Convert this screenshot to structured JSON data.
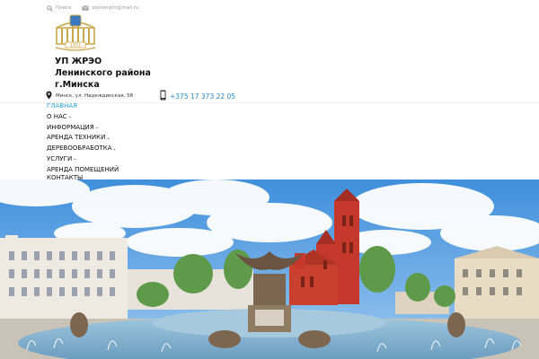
{
  "topbar": {
    "search_label": "Поиск",
    "email": "zooleniprr@mail.ru"
  },
  "logo": {
    "year": "1951"
  },
  "org": {
    "title_line1": "УП ЖРЭО",
    "title_line2": "Ленинского района",
    "title_line3": "г.Минска"
  },
  "contacts": {
    "address": "Минск, ул. Надеждинская, 58",
    "phone": "+375 17 373 22 05"
  },
  "nav": {
    "items": [
      {
        "label": "ГЛАВНАЯ"
      },
      {
        "label": "О НАС"
      },
      {
        "label": "ИНФОРМАЦИЯ"
      },
      {
        "label": "АРЕНДА ТЕХНИКИ"
      },
      {
        "label": "ДЕРЕВООБРАБОТКА"
      },
      {
        "label": "УСЛУГИ"
      },
      {
        "label": "АРЕНДА ПОМЕЩЕНИЙ"
      },
      {
        "label": "КОНТАКТЫ"
      }
    ]
  },
  "colors": {
    "accent": "#2aa0d8",
    "phone": "#2a8cc8",
    "logo_gold": "#c9a64a",
    "sky": "#4f9be0",
    "church_red": "#c4392b"
  },
  "icons": {
    "search": "search-icon",
    "email": "envelope-icon",
    "location": "map-pin-icon",
    "phone": "mobile-phone-icon",
    "submenu": "chevron-down-icon"
  }
}
